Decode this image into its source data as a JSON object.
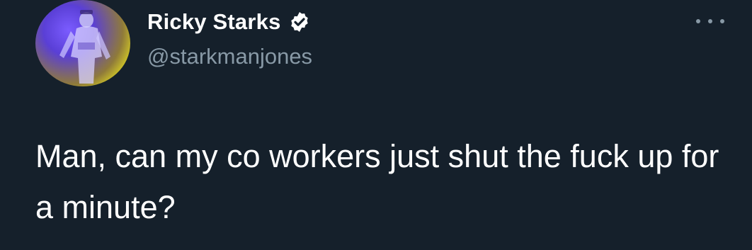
{
  "tweet": {
    "author": {
      "display_name": "Ricky Starks",
      "handle": "@starkmanjones",
      "verified": true,
      "avatar_icon": "profile-photo"
    },
    "menu_icon": "more-options-icon",
    "text": "Man, can my co workers just shut the fuck up for a minute?"
  },
  "colors": {
    "background": "#15202b",
    "primary_text": "#ffffff",
    "secondary_text": "#8899a6",
    "verified_badge": "#ffffff"
  }
}
